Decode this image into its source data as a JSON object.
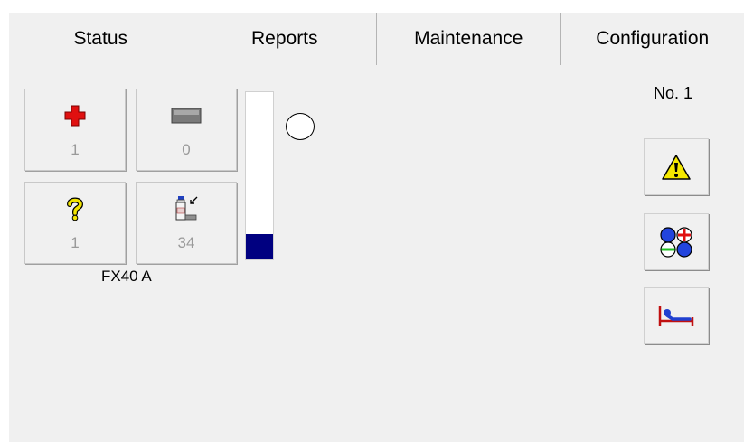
{
  "tabs": [
    {
      "label": "Status"
    },
    {
      "label": "Reports"
    },
    {
      "label": "Maintenance"
    },
    {
      "label": "Configuration"
    }
  ],
  "tiles": [
    {
      "icon": "red-cross-icon",
      "count": "1"
    },
    {
      "icon": "gray-rectangle-icon",
      "count": "0"
    },
    {
      "icon": "question-mark-icon",
      "count": "1"
    },
    {
      "icon": "reagent-bottle-icon",
      "count": "34"
    }
  ],
  "device": {
    "label": "FX40 A"
  },
  "level": {
    "fill_fraction": 0.15,
    "color": "#000080"
  },
  "unit": {
    "label": "No.  1"
  },
  "side_buttons": [
    {
      "icon": "warning-icon"
    },
    {
      "icon": "quality-control-icon"
    },
    {
      "icon": "patient-bed-icon"
    }
  ],
  "colors": {
    "background": "#f0f0f0",
    "count_text": "#9a9a9a"
  }
}
